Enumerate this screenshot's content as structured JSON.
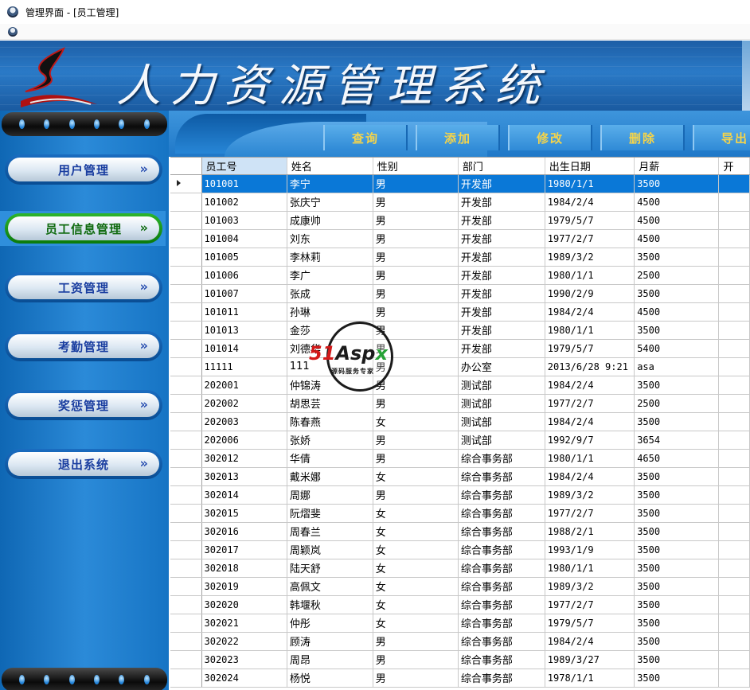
{
  "window": {
    "title": "管理界面 - [员工管理]"
  },
  "banner": {
    "title": "人力资源管理系统"
  },
  "sidebar": {
    "items": [
      {
        "label": "用户管理",
        "chevron": "»",
        "active": false
      },
      {
        "label": "员工信息管理",
        "chevron": "»",
        "active": true
      },
      {
        "label": "工资管理",
        "chevron": "»",
        "active": false
      },
      {
        "label": "考勤管理",
        "chevron": "»",
        "active": false
      },
      {
        "label": "奖惩管理",
        "chevron": "»",
        "active": false
      },
      {
        "label": "退出系统",
        "chevron": "»",
        "active": false
      }
    ]
  },
  "toolbar": {
    "buttons": [
      "查询",
      "添加",
      "修改",
      "删除",
      "导出"
    ]
  },
  "grid": {
    "columns": [
      "员工号",
      "姓名",
      "性别",
      "部门",
      "出生日期",
      "月薪",
      "开"
    ],
    "sorted_column": 0,
    "selected_row": 0,
    "rows": [
      [
        "101001",
        "李宁",
        "男",
        "开发部",
        "1980/1/1",
        "3500"
      ],
      [
        "101002",
        "张庆宁",
        "男",
        "开发部",
        "1984/2/4",
        "4500"
      ],
      [
        "101003",
        "成康帅",
        "男",
        "开发部",
        "1979/5/7",
        "4500"
      ],
      [
        "101004",
        "刘东",
        "男",
        "开发部",
        "1977/2/7",
        "4500"
      ],
      [
        "101005",
        "李林莉",
        "男",
        "开发部",
        "1989/3/2",
        "3500"
      ],
      [
        "101006",
        "李广",
        "男",
        "开发部",
        "1980/1/1",
        "2500"
      ],
      [
        "101007",
        "张成",
        "男",
        "开发部",
        "1990/2/9",
        "3500"
      ],
      [
        "101011",
        "孙琳",
        "男",
        "开发部",
        "1984/2/4",
        "4500"
      ],
      [
        "101013",
        "金莎",
        "男",
        "开发部",
        "1980/1/1",
        "3500"
      ],
      [
        "101014",
        "刘德华",
        "男",
        "开发部",
        "1979/5/7",
        "5400"
      ],
      [
        "11111",
        "111",
        "男",
        "办公室",
        "2013/6/28 9:21",
        "asa"
      ],
      [
        "202001",
        "仲锦涛",
        "男",
        "测试部",
        "1984/2/4",
        "3500"
      ],
      [
        "202002",
        "胡思芸",
        "男",
        "测试部",
        "1977/2/7",
        "2500"
      ],
      [
        "202003",
        "陈春燕",
        "女",
        "测试部",
        "1984/2/4",
        "3500"
      ],
      [
        "202006",
        "张娇",
        "男",
        "测试部",
        "1992/9/7",
        "3654"
      ],
      [
        "302012",
        "华倩",
        "男",
        "综合事务部",
        "1980/1/1",
        "4650"
      ],
      [
        "302013",
        "戴米娜",
        "女",
        "综合事务部",
        "1984/2/4",
        "3500"
      ],
      [
        "302014",
        "周娜",
        "男",
        "综合事务部",
        "1989/3/2",
        "3500"
      ],
      [
        "302015",
        "阮熠斐",
        "女",
        "综合事务部",
        "1977/2/7",
        "3500"
      ],
      [
        "302016",
        "周春兰",
        "女",
        "综合事务部",
        "1988/2/1",
        "3500"
      ],
      [
        "302017",
        "周颖岚",
        "女",
        "综合事务部",
        "1993/1/9",
        "3500"
      ],
      [
        "302018",
        "陆天舒",
        "女",
        "综合事务部",
        "1980/1/1",
        "3500"
      ],
      [
        "302019",
        "高佩文",
        "女",
        "综合事务部",
        "1989/3/2",
        "3500"
      ],
      [
        "302020",
        "韩堰秋",
        "女",
        "综合事务部",
        "1977/2/7",
        "3500"
      ],
      [
        "302021",
        "仲彤",
        "女",
        "综合事务部",
        "1979/5/7",
        "3500"
      ],
      [
        "302022",
        "顾涛",
        "男",
        "综合事务部",
        "1984/2/4",
        "3500"
      ],
      [
        "302023",
        "周昂",
        "男",
        "综合事务部",
        "1989/3/27",
        "3500"
      ],
      [
        "302024",
        "杨悦",
        "男",
        "综合事务部",
        "1978/1/1",
        "3500"
      ]
    ]
  },
  "watermark": {
    "brand_51": "51",
    "brand_asp": "Asp",
    "brand_x": "x",
    "subtitle": "源码服务专家"
  }
}
